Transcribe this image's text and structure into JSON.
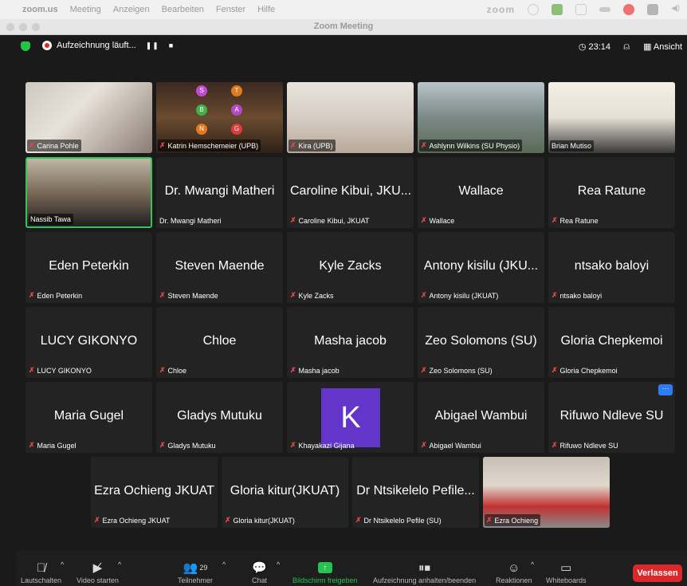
{
  "menubar": {
    "app": "zoom.us",
    "items": [
      "Meeting",
      "Anzeigen",
      "Bearbeiten",
      "Fenster",
      "Hilfe"
    ],
    "brand": "zoom"
  },
  "window": {
    "title": "Zoom Meeting"
  },
  "topbar": {
    "recording_label": "Aufzeichnung läuft...",
    "timer": "23:14",
    "view_label": "Ansicht"
  },
  "tiles": [
    {
      "name": "Carina Pohle",
      "big": "",
      "video": true,
      "muted": true
    },
    {
      "name": "Katrin Hemschemeier (UPB)",
      "big": "",
      "video": true,
      "muted": true
    },
    {
      "name": "Kira (UPB)",
      "big": "",
      "video": true,
      "muted": true
    },
    {
      "name": "Ashlynn Wilkins (SU Physio)",
      "big": "",
      "video": true,
      "muted": true
    },
    {
      "name": "Brian Mutiso",
      "big": "",
      "video": true,
      "muted": false
    },
    {
      "name": "Nassib Tawa",
      "big": "",
      "video": true,
      "muted": false,
      "active": true
    },
    {
      "name": "Dr. Mwangi Matheri",
      "big": "Dr. Mwangi Matheri",
      "video": false,
      "muted": false
    },
    {
      "name": "Caroline Kibui, JKUAT",
      "big": "Caroline Kibui, JKU...",
      "video": false,
      "muted": true
    },
    {
      "name": "Wallace",
      "big": "Wallace",
      "video": false,
      "muted": true
    },
    {
      "name": "Rea Ratune",
      "big": "Rea Ratune",
      "video": false,
      "muted": true
    },
    {
      "name": "Eden Peterkin",
      "big": "Eden Peterkin",
      "video": false,
      "muted": true
    },
    {
      "name": "Steven Maende",
      "big": "Steven Maende",
      "video": false,
      "muted": true
    },
    {
      "name": "Kyle Zacks",
      "big": "Kyle Zacks",
      "video": false,
      "muted": true
    },
    {
      "name": "Antony kisilu (JKUAT)",
      "big": "Antony kisilu (JKU...",
      "video": false,
      "muted": true
    },
    {
      "name": "ntsako baloyi",
      "big": "ntsako baloyi",
      "video": false,
      "muted": true
    },
    {
      "name": "LUCY GIKONYO",
      "big": "LUCY GIKONYO",
      "video": false,
      "muted": true
    },
    {
      "name": "Chloe",
      "big": "Chloe",
      "video": false,
      "muted": true
    },
    {
      "name": "Masha jacob",
      "big": "Masha jacob",
      "video": false,
      "muted": true
    },
    {
      "name": "Zeo Solomons  (SU)",
      "big": "Zeo Solomons  (SU)",
      "video": false,
      "muted": true
    },
    {
      "name": "Gloria Chepkemoi",
      "big": "Gloria Chepkemoi",
      "video": false,
      "muted": true
    },
    {
      "name": "Maria Gugel",
      "big": "Maria Gugel",
      "video": false,
      "muted": true
    },
    {
      "name": "Gladys Mutuku",
      "big": "Gladys Mutuku",
      "video": false,
      "muted": true
    },
    {
      "name": "Khayakazi Gijana",
      "big": "",
      "avatar_letter": "K",
      "video": false,
      "muted": true
    },
    {
      "name": "Abigael Wambui",
      "big": "Abigael Wambui",
      "video": false,
      "muted": true
    },
    {
      "name": "Rifuwo Ndleve SU",
      "big": "Rifuwo Ndleve SU",
      "video": false,
      "muted": true,
      "more": "···"
    },
    {
      "name": "Ezra Ochieng JKUAT",
      "big": "Ezra Ochieng JKUAT",
      "video": false,
      "muted": true
    },
    {
      "name": "Gloria kitur(JKUAT)",
      "big": "Gloria kitur(JKUAT)",
      "video": false,
      "muted": true
    },
    {
      "name": "Dr Ntsikelelo Pefile (SU)",
      "big": "Dr Ntsikelelo Pefile...",
      "video": false,
      "muted": true
    },
    {
      "name": "Ezra Ochieng",
      "big": "",
      "video": true,
      "muted": true
    }
  ],
  "toolbar": {
    "mute": "Lautschalten",
    "video": "Video starten",
    "participants": "Teilnehmer",
    "participants_count": "29",
    "chat": "Chat",
    "share": "Bildschirm freigeben",
    "record": "Aufzeichnung anhalten/beenden",
    "reactions": "Reaktionen",
    "whiteboards": "Whiteboards",
    "leave": "Verlassen"
  }
}
